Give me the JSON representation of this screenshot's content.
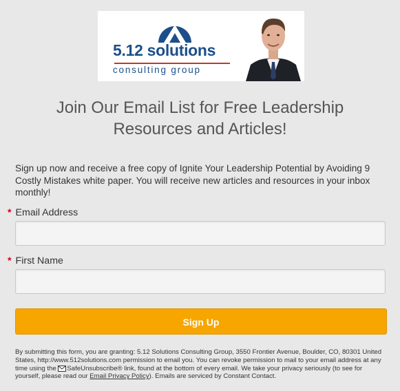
{
  "banner": {
    "brand_name": "5.12 solutions",
    "brand_sub": "consulting group"
  },
  "form": {
    "headline": "Join Our Email List for Free Leadership Resources and Articles!",
    "intro": "Sign up now and receive a free copy of Ignite Your Leadership Potential by Avoiding 9 Costly Mistakes white paper. You will receive new articles and resources in your inbox monthly!",
    "required_marker": "*",
    "email_label": "Email Address",
    "email_value": "",
    "first_name_label": "First Name",
    "first_name_value": "",
    "submit_label": "Sign Up"
  },
  "disclaimer": {
    "part1": "By submitting this form, you are granting: 5.12 Solutions Consulting Group, 3550 Frontier Avenue, Boulder, CO, 80301 United States, http://www.512solutions.com permission to email you. You can revoke permission to mail to your email address at any time using the",
    "safe_unsubscribe": "SafeUnsubscribe®",
    "part2": "link, found at the bottom of every email. We take your privacy seriously (to see for yourself, please read our",
    "privacy_link": "Email Privacy Policy",
    "part3": "). Emails are serviced by Constant Contact."
  },
  "colors": {
    "background": "#e8e8e8",
    "brand_blue": "#1c4f8a",
    "accent_red": "#c0392b",
    "button_orange": "#f7a600",
    "required_red": "#d0021b"
  }
}
